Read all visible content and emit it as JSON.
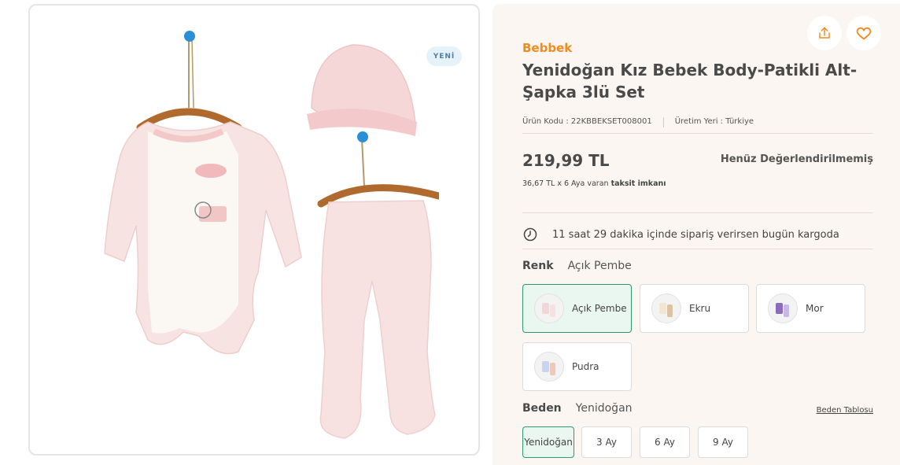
{
  "gallery": {
    "badge": "YENİ",
    "image_icon": "baby-outfit-illustration"
  },
  "actions": {
    "share_icon": "share-icon",
    "favorite_icon": "heart-icon"
  },
  "product": {
    "brand": "Bebbek",
    "title": "Yenidoğan Kız Bebek Body-Patikli Alt-Şapka 3lü Set",
    "code_text": "Ürün Kodu : 22KBBEKSET008001",
    "origin_text": "Üretim Yeri : Türkiye",
    "price": "219,99 TL",
    "rating_text": "Henüz Değerlendirilmemiş",
    "installment_prefix": "36,67 TL x 6 Aya varan ",
    "installment_bold": "taksit imkanı",
    "shipping_text": "11 saat 29 dakika içinde sipariş verirsen bugün kargoda"
  },
  "color": {
    "label": "Renk",
    "selected_value": "Açık Pembe",
    "options": [
      {
        "label": "Açık Pembe",
        "selected": true
      },
      {
        "label": "Ekru",
        "selected": false
      },
      {
        "label": "Mor",
        "selected": false
      },
      {
        "label": "Pudra",
        "selected": false
      }
    ]
  },
  "size": {
    "label": "Beden",
    "selected_value": "Yenidoğan",
    "table_link": "Beden Tablosu",
    "options": [
      {
        "label": "Yenidoğan",
        "selected": true
      },
      {
        "label": "3 Ay",
        "selected": false
      },
      {
        "label": "6 Ay",
        "selected": false
      },
      {
        "label": "9 Ay",
        "selected": false
      }
    ]
  },
  "colors": {
    "brand_orange": "#f28b1f",
    "selected_green": "#2f9a6e",
    "panel_bg": "#fbf6f1",
    "badge_bg": "#e6f2fa"
  }
}
